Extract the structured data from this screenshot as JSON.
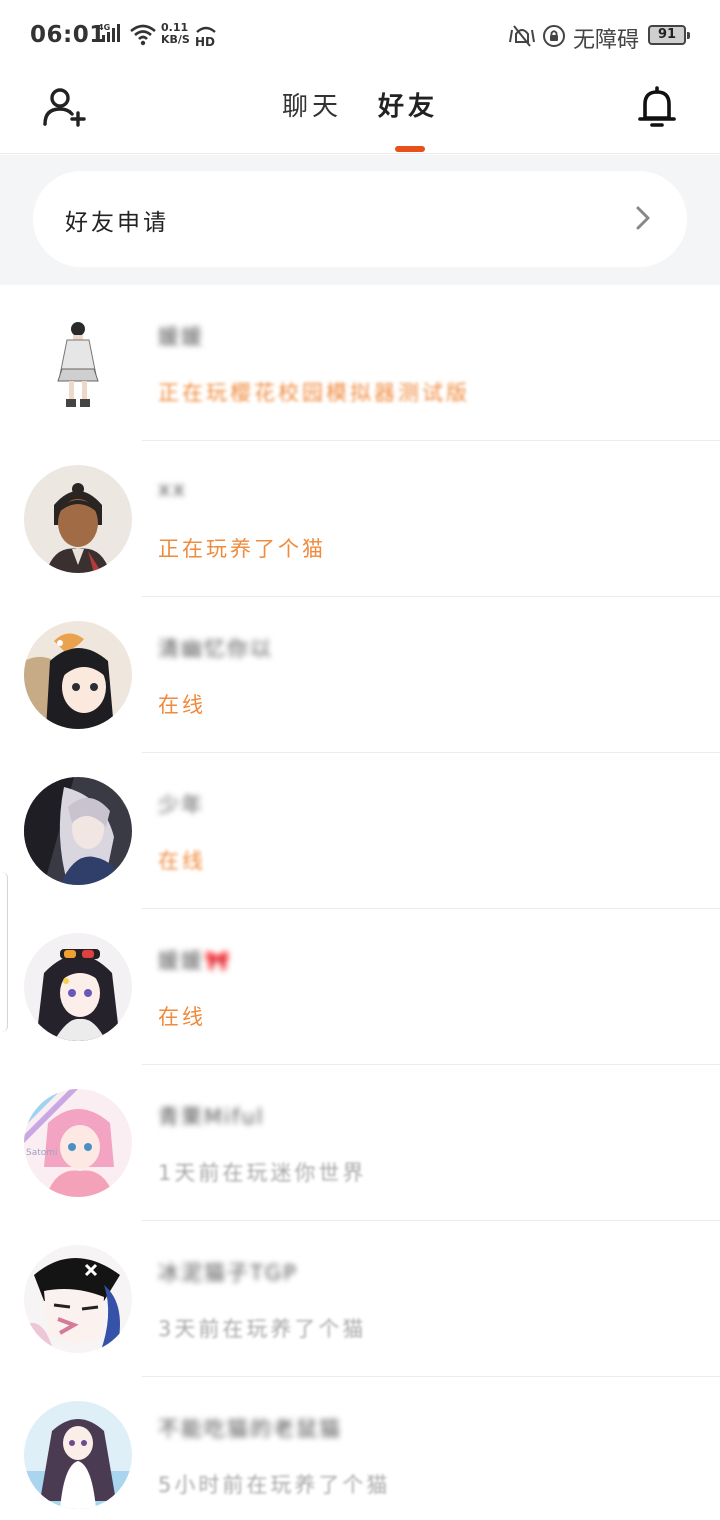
{
  "status_bar": {
    "time": "06:01",
    "network": "4G",
    "net_speed_value": "0.11",
    "net_speed_unit": "KB/S",
    "hd": "HD",
    "accessibility_label": "无障碍",
    "battery_level": "91"
  },
  "header": {
    "tabs": [
      {
        "label": "聊天",
        "active": false
      },
      {
        "label": "好友",
        "active": true
      }
    ],
    "accent_color": "#e8521a"
  },
  "friend_request": {
    "label": "好友申请"
  },
  "friends": [
    {
      "name": "媛媛",
      "status": "正在玩樱花校园模拟器测试版",
      "online": true
    },
    {
      "name": "xx",
      "status": "正在玩养了个猫",
      "online": true
    },
    {
      "name": "清幽忆你以",
      "status": "在线",
      "online": true
    },
    {
      "name": "少年",
      "status": "在线",
      "online": true
    },
    {
      "name": "媛媛🎀",
      "status": "在线",
      "online": true
    },
    {
      "name": "青栗Miful",
      "status": "1天前在玩迷你世界",
      "online": false
    },
    {
      "name": "冰泥猫子TGP",
      "status": "3天前在玩养了个猫",
      "online": false
    },
    {
      "name": "不能吃猫的老鼠猫",
      "status": "5小时前在玩养了个猫",
      "online": false
    }
  ],
  "icons": {
    "add_friend": "add-user-icon",
    "notifications": "bell-icon",
    "chevron": "chevron-right-icon"
  }
}
